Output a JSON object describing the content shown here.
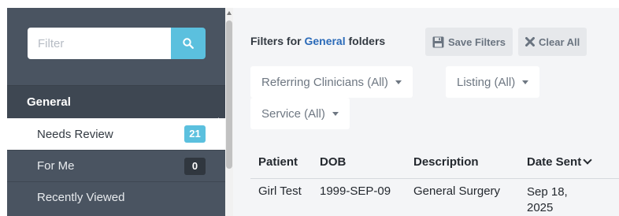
{
  "sidebar": {
    "filter": {
      "placeholder": "Filter",
      "value": ""
    },
    "section_title": "General",
    "items": [
      {
        "label": "Needs Review",
        "count": "21",
        "active": true
      },
      {
        "label": "For Me",
        "count": "0",
        "active": false
      },
      {
        "label": "Recently Viewed",
        "active": false
      }
    ]
  },
  "main": {
    "filters_title": {
      "prefix": "Filters for ",
      "folder": "General",
      "suffix": " folders"
    },
    "save_filters_label": "Save Filters",
    "clear_all_label": "Clear All",
    "dropdowns": [
      {
        "label": "Referring Clinicians (All)"
      },
      {
        "label": "Listing (All)"
      },
      {
        "label": "Service (All)"
      }
    ],
    "table": {
      "columns": [
        "Patient",
        "DOB",
        "Description",
        "Date Sent"
      ],
      "rows": [
        {
          "patient": "Girl Test",
          "dob": "1999-SEP-09",
          "description": "General Surgery",
          "date_sent_line1": "Sep 18,",
          "date_sent_line2": "2025"
        }
      ]
    }
  },
  "colors": {
    "sidebar_bg": "#4a5461",
    "section_bg": "#3e4752",
    "accent_cyan": "#5bc0de",
    "link_blue": "#2a6ab8",
    "main_bg": "#f4f5f7"
  },
  "icons": {
    "search": "search-icon",
    "save": "floppy-disk-icon",
    "clear": "x-icon",
    "sort": "chevron-down-icon"
  }
}
